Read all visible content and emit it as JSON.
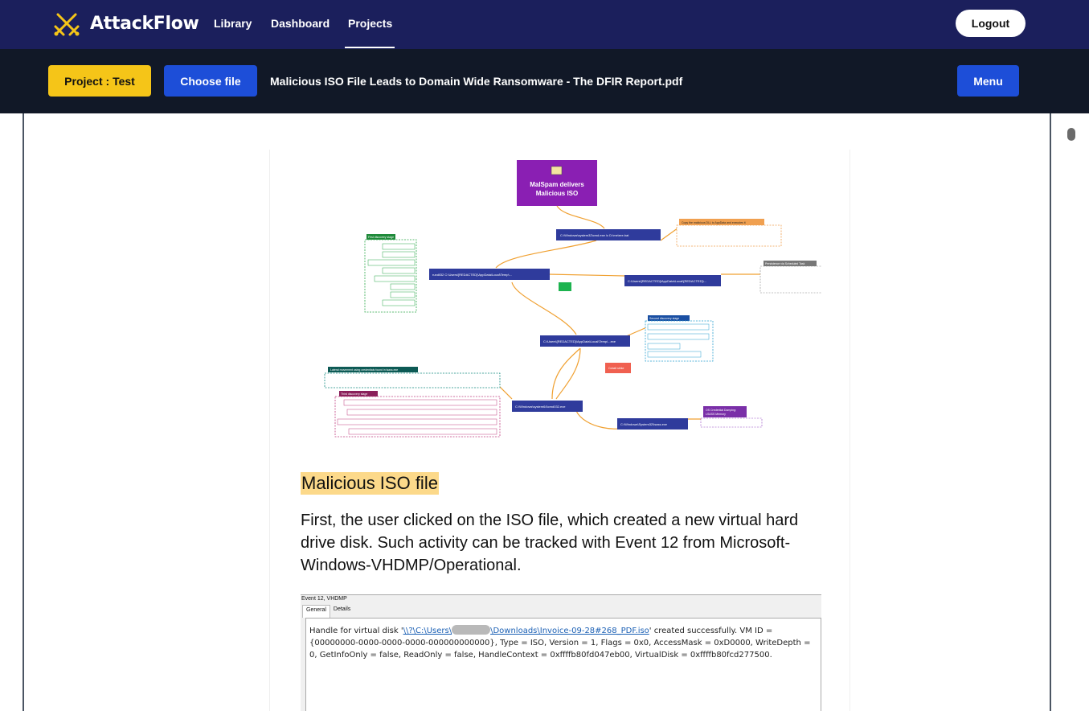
{
  "app": {
    "name": "AttackFlow",
    "nav": [
      {
        "label": "Library"
      },
      {
        "label": "Dashboard"
      },
      {
        "label": "Projects"
      }
    ],
    "logout_label": "Logout"
  },
  "toolbar": {
    "project_label": "Project : Test",
    "choose_file_label": "Choose file",
    "filename": "Malicious ISO File Leads to Domain Wide Ransomware - The DFIR Report.pdf",
    "menu_label": "Menu"
  },
  "document": {
    "diagram": {
      "root": "MalSpam delivers Malicious ISO",
      "nodes": [
        "C:\\Windows\\system32\\cmd.exe /c D:\\me\\ere.bat",
        "rundll32 C:\\Users\\[REDACTED]\\AppData\\Local\\Temp\\...",
        "C:\\Users\\[REDACTED]\\AppData\\Local\\[REDACTED]\\...",
        "C:\\Users\\[REDACTED]\\AppData\\Local\\Temp\\...exe",
        "C:\\Windows\\system64\\cmd032.exe",
        "C:\\Windows\\System32\\lsass.exe"
      ],
      "boxes": [
        "First discovery stage",
        "Second discovery stage",
        "Third discovery stage",
        "Lateral movement using credentials found in lsass.exe",
        "Copy the malicious DLL to AppData and executes it",
        "Persistence via Scheduled Task",
        "OS Credential Dumping: LSASS Memory",
        "Cobalt strike"
      ]
    },
    "heading": "Malicious ISO file",
    "paragraph": "First, the user clicked on the ISO file, which created a new virtual hard drive disk. Such activity can be tracked with Event 12 from Microsoft-Windows-VHDMP/Operational.",
    "event": {
      "title": "Event 12, VHDMP",
      "tabs": [
        "General",
        "Details"
      ],
      "text_before": "Handle for virtual disk '",
      "link_a": "\\\\?\\C:\\Users\\",
      "link_b": "\\Downloads\\Invoice-09-28#268_PDF.iso",
      "text_after": "' created successfully. VM ID = {00000000-0000-0000-0000-000000000000}, Type = ISO, Version = 1, Flags = 0x0, AccessMask = 0xD0000, WriteDepth = 0, GetInfoOnly = false, ReadOnly = false, HandleContext = 0xffffb80fd047eb00, VirtualDisk = 0xffffb80fcd277500."
    }
  },
  "colors": {
    "nav_bg": "#1b1f5c",
    "toolbar_bg": "#111827",
    "project_btn": "#f5c518",
    "primary_btn": "#1d4ed8",
    "highlight": "#fcd98a"
  }
}
